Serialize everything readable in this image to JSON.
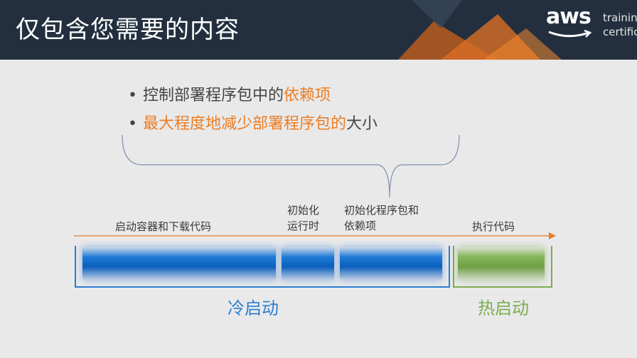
{
  "header": {
    "title": "仅包含您需要的内容",
    "logo": {
      "brand": "aws",
      "line1": "trainin",
      "line2": "certific"
    }
  },
  "bullets": [
    {
      "normal_before": "控制部署程序包中的",
      "highlight": "依赖项",
      "normal_after": ""
    },
    {
      "normal_before": "",
      "highlight": "最大程度地减少部署程序包的",
      "normal_after": "大小"
    }
  ],
  "timeline": {
    "segments": [
      {
        "label": "启动容器和下载代码"
      },
      {
        "label_line1": "初始化",
        "label_line2": "运行时"
      },
      {
        "label_line1": "初始化程序包和",
        "label_line2": "依赖项"
      },
      {
        "label": "执行代码"
      }
    ],
    "cold_start": "冷启动",
    "warm_start": "热启动"
  },
  "colors": {
    "header_bg": "#232f3e",
    "accent_orange": "#ec7d22",
    "cold_blue": "#1e7bd6",
    "warm_green": "#86b55a"
  }
}
